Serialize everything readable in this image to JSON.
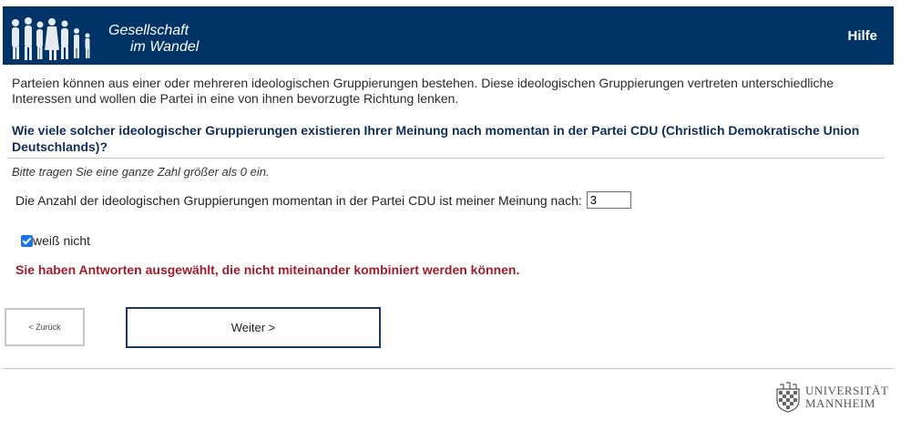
{
  "header": {
    "logo_line1": "Gesellschaft",
    "logo_line2": "im Wandel",
    "help_label": "Hilfe",
    "background_color": "#003466"
  },
  "intro_text": "Parteien können aus einer oder mehreren ideologischen Gruppierungen bestehen. Diese ideologischen Gruppierungen vertreten unterschiedliche Interessen und wollen die Partei in eine von ihnen bevorzugte Richtung lenken.",
  "question": "Wie viele solcher ideologischer Gruppierungen existieren Ihrer Meinung nach momentan in der Partei CDU (Christlich Demokratische Union Deutschlands)?",
  "hint": "Bitte tragen Sie eine ganze Zahl größer als 0 ein.",
  "answer": {
    "label": "Die Anzahl der ideologischen Gruppierungen momentan in der Partei CDU ist meiner Meinung nach:",
    "value": "3"
  },
  "dont_know": {
    "label": "weiß nicht",
    "checked": true
  },
  "error_message": "Sie haben Antworten ausgewählt, die nicht miteinander kombiniert werden können.",
  "buttons": {
    "back": "< Zurück",
    "next": "Weiter >"
  },
  "footer": {
    "university_line1": "UNIVERSITÄT",
    "university_line2": "MANNHEIM"
  },
  "colors": {
    "accent": "#003466",
    "error": "#a01c2b",
    "question": "#0f2d5a"
  }
}
